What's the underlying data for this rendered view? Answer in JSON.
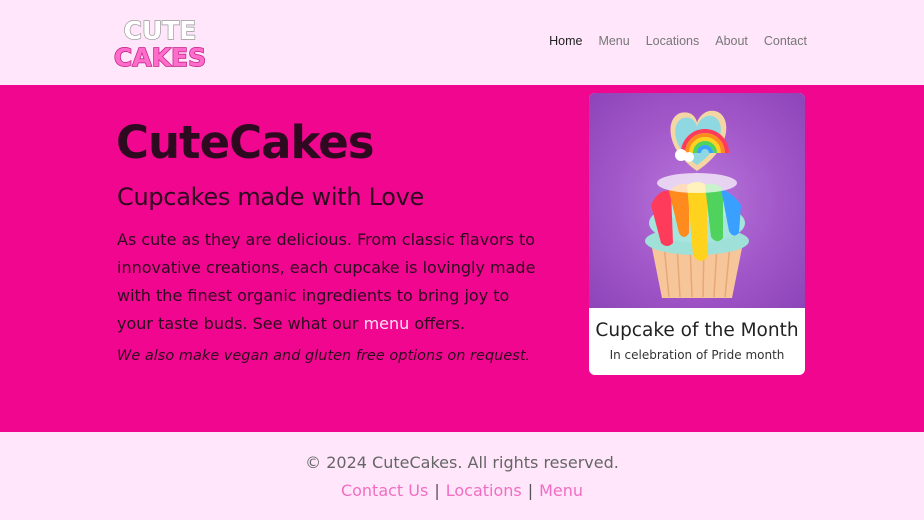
{
  "header": {
    "logo_text": [
      "CUTE",
      "CAKES"
    ],
    "nav": [
      {
        "label": "Home",
        "active": true
      },
      {
        "label": "Menu",
        "active": false
      },
      {
        "label": "Locations",
        "active": false
      },
      {
        "label": "About",
        "active": false
      },
      {
        "label": "Contact",
        "active": false
      }
    ]
  },
  "hero": {
    "title": "CuteCakes",
    "subtitle": "Cupcakes made with Love",
    "description_before": "As cute as they are delicious. From classic flavors to innovative creations, each cupcake is lovingly made with the finest organic ingredients to bring joy to your taste buds. See what our ",
    "description_link": "menu",
    "description_after": " offers.",
    "note": "We also make vegan and gluten free options on request."
  },
  "card": {
    "title": "Cupcake of the Month",
    "subtitle": "In celebration of Pride month"
  },
  "footer": {
    "copyright": "© 2024 CuteCakes. All rights reserved.",
    "links": [
      "Contact Us",
      "Locations",
      "Menu"
    ],
    "separator": "|"
  },
  "colors": {
    "hero_bg": "#f0068f",
    "page_bg": "#ffe6fb",
    "link_pink": "#f06ec2"
  }
}
